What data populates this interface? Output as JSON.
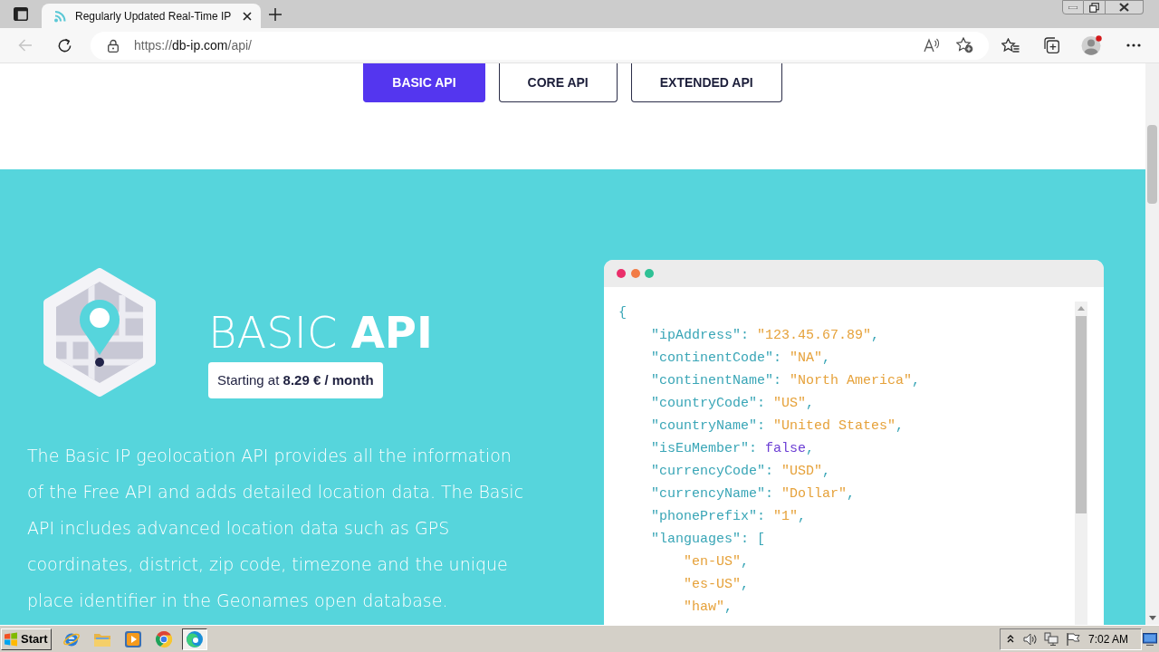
{
  "browser": {
    "tabs": [
      {
        "title": "Regularly Updated Real-Time IP",
        "selected": true
      }
    ],
    "address_bar": {
      "url_scheme": "https://",
      "url_host": "db-ip.com",
      "url_path": "/api/"
    }
  },
  "page": {
    "plan_tabs": [
      {
        "label": "BASIC API",
        "selected": true
      },
      {
        "label": "CORE API",
        "selected": false
      },
      {
        "label": "EXTENDED API",
        "selected": false
      }
    ],
    "hero": {
      "title": "BASIC **API**",
      "price": "Starting at **8.29 € / month**",
      "description": "The Basic IP geolocation API provides all the information of the Free API and adds detailed location data. The Basic API includes advanced location data such as GPS coordinates, district, zip code, timezone and the unique place identifier in the Geonames open database."
    },
    "code_sample": {
      "lines": [
        "{",
        "    \"ipAddress\": \"123.45.67.89\",",
        "    \"continentCode\": \"NA\",",
        "    \"continentName\": \"North America\",",
        "    \"countryCode\": \"US\",",
        "    \"countryName\": \"United States\",",
        "    \"isEuMember\": false,",
        "    \"currencyCode\": \"USD\",",
        "    \"currencyName\": \"Dollar\",",
        "    \"phonePrefix\": \"1\",",
        "    \"languages\": [",
        "        \"en-US\",",
        "        \"es-US\",",
        "        \"haw\","
      ]
    }
  },
  "taskbar": {
    "start": "Start",
    "apps": [
      {
        "kind": "internet-explorer",
        "selected": false
      },
      {
        "kind": "folder",
        "selected": false
      },
      {
        "kind": "media-player",
        "selected": false
      },
      {
        "kind": "chrome",
        "selected": false
      },
      {
        "kind": "edge",
        "selected": true
      }
    ],
    "clock": "7:02 AM"
  }
}
